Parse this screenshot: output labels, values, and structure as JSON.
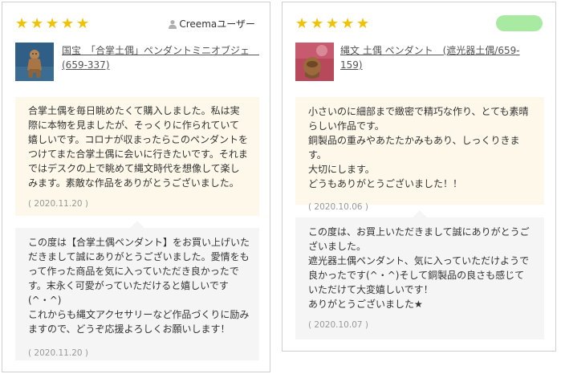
{
  "colors": {
    "star": "#f2c200",
    "review_bg": "#fdf8ea",
    "reply_bg": "#f5f5f5",
    "badge": "#a9eaa3",
    "border": "#cfcfcf"
  },
  "cards": [
    {
      "stars": [
        "★",
        "★",
        "★",
        "★",
        "★"
      ],
      "rating": 5,
      "user_icon": "person-icon",
      "user_label": "Creemaユーザー",
      "product_name": "国宝　「合掌土偶」ペンダントミニオブジェ　(659-337)",
      "review_text": "合掌土偶を毎日眺めたくて購入しました。私は実際に本物を見ましたが、そっくりに作られていて嬉しいです。コロナが収まったらこのペンダントをつけてまた合掌土偶に会いに行きたいです。それまではデスクの上で眺めて縄文時代を想像して楽しみます。素敵な作品をありがとうございました。",
      "review_date": "( 2020.11.20 )",
      "reply_text": "この度は【合掌土偶ペンダント】をお買い上げいただきまして誠にありがとうございました。愛情をもって作った商品を気に入っていただき良かったです。末永く可愛がっていただけると嬉しいです(^・^)\nこれからも縄文アクセサリーなど作品づくりに励みますので、どうぞ応援よろしくお願いします！",
      "reply_date": "( 2020.11.20 )"
    },
    {
      "stars": [
        "★",
        "★",
        "★",
        "★",
        "★"
      ],
      "rating": 5,
      "product_name": "縄文 土偶 ペンダント　(遮光器土偶/659-159)",
      "review_text": "小さいのに細部まで緻密で精巧な作り、とても素晴らしい作品です。\n銅製品の重みやあたたかみもあり、しっくりきます。\n大切にします。\nどうもありがとうございました！！",
      "review_date": "( 2020.10.06 )",
      "reply_text": "この度は、お買上いただきまして誠にありがとうございました。\n遮光器土偶ペンダント、気に入っていただけようで良かったです(^・^)そして銅製品の良さも感じていただけて大変嬉しいです！\nありがとうございました★",
      "reply_date": "( 2020.10.07 )"
    }
  ]
}
